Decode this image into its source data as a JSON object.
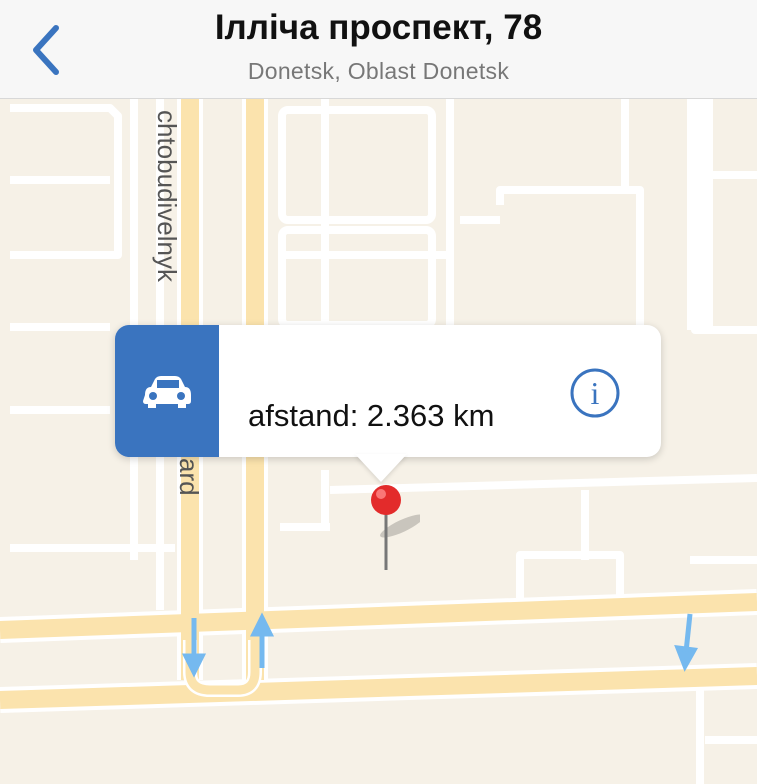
{
  "header": {
    "title": "Ілліча проспект, 78",
    "subtitle": "Donetsk, Oblast Donetsk",
    "back_icon": "chevron-left-icon"
  },
  "map": {
    "street_labels": [
      "chtobudivelnyk",
      "ard"
    ],
    "callout": {
      "distance_text": "afstand: 2.363 km",
      "transport_icon": "car-icon",
      "info_icon": "info-icon"
    }
  },
  "colors": {
    "accent": "#3a74bf",
    "map_background": "#f6f1e7",
    "road_major": "#fbe3ad",
    "road_minor": "#ffffff",
    "pin": "#e32b2b",
    "arrow": "#75b9ef"
  }
}
